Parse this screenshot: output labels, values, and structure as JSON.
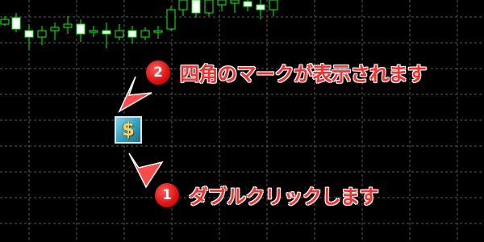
{
  "chart": {
    "colors": {
      "background": "#000000",
      "grid": "#5a5a5a",
      "candle": "#00ff00",
      "bull_fill": "#000000",
      "bear_fill": "#ffffff"
    }
  },
  "expert_icon": {
    "symbol": "$",
    "icon": "dollar-icon"
  },
  "annotations": [
    {
      "number": "2",
      "text": "四角のマークが表示されます",
      "color": "#ff2a2a"
    },
    {
      "number": "1",
      "text": "ダブルクリックします",
      "color": "#ff2a2a"
    }
  ]
}
